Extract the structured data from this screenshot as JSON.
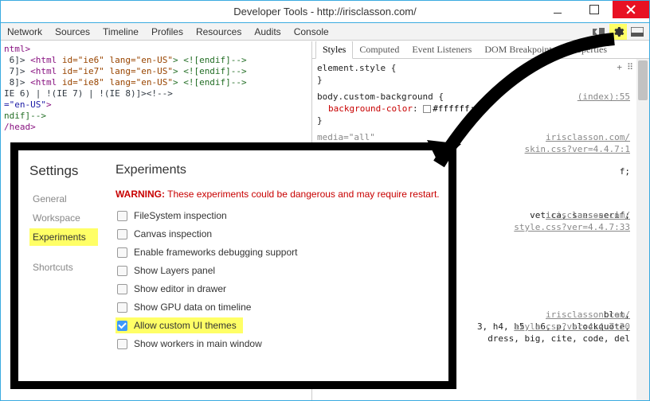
{
  "window": {
    "title": "Developer Tools - http://irisclasson.com/"
  },
  "toolbar": {
    "tabs": [
      "Network",
      "Sources",
      "Timeline",
      "Profiles",
      "Resources",
      "Audits",
      "Console"
    ]
  },
  "html_lines": [
    {
      "pre": "",
      "txt": "ntml>"
    },
    {
      "pre": " 6]> ",
      "tag": "<html ",
      "attr": "id=\"ie6\" lang=\"en-US\"",
      "tail": "> <![endif]-->"
    },
    {
      "pre": " 7]> ",
      "tag": "<html ",
      "attr": "id=\"ie7\" lang=\"en-US\"",
      "tail": "> <![endif]-->"
    },
    {
      "pre": " 8]> ",
      "tag": "<html ",
      "attr": "id=\"ie8\" lang=\"en-US\"",
      "tail": "> <![endif]-->"
    },
    {
      "pre": "",
      "txt": "IE 6) | !(IE 7) | !(IE 8)]><!-->"
    },
    {
      "pre": "",
      "attr2": "=\"en-US\"",
      "tail2": ">"
    },
    {
      "pre": "",
      "cmt": "ndif]-->"
    },
    {
      "pre": "",
      "tag2": "/head>"
    }
  ],
  "styles": {
    "tabs": [
      "Styles",
      "Computed",
      "Event Listeners",
      "DOM Breakpoints",
      "Properties"
    ],
    "active": 0,
    "blocks": [
      {
        "sel": "element.style {",
        "link": "",
        "props": [],
        "close": "}"
      },
      {
        "sel": "body.custom-background {",
        "link": "(index):55",
        "props": [
          {
            "n": "background-color",
            "v": "#ffffff",
            "chip": true
          }
        ],
        "close": "}"
      },
      {
        "sel": "media=\"all\"",
        "link": "irisclasson.com/\nskin.css?ver=4.4.7:1",
        "frag": "f;"
      },
      {
        "link": "irisclasson.com/\nstyle.css?ver=4.4.7:33",
        "frag": "vetica, sans-serif;"
      },
      {
        "link": "irisclasson.com/\nstyle.css?ver=4.4.7:20",
        "frag": "3, h4, h5, h6, p, blockquote,",
        "extra1": "blet,",
        "extra2": "dress, big, cite, code, del"
      }
    ]
  },
  "settings": {
    "title": "Settings",
    "heading": "Experiments",
    "nav": [
      "General",
      "Workspace",
      "Experiments",
      "Shortcuts"
    ],
    "nav_active": 2,
    "warning_label": "WARNING:",
    "warning_text": " These experiments could be dangerous and may require restart.",
    "items": [
      {
        "label": "FileSystem inspection",
        "checked": false,
        "hl": false
      },
      {
        "label": "Canvas inspection",
        "checked": false,
        "hl": false
      },
      {
        "label": "Enable frameworks debugging support",
        "checked": false,
        "hl": false
      },
      {
        "label": "Show Layers panel",
        "checked": false,
        "hl": false
      },
      {
        "label": "Show editor in drawer",
        "checked": false,
        "hl": false
      },
      {
        "label": "Show GPU data on timeline",
        "checked": false,
        "hl": false
      },
      {
        "label": "Allow custom UI themes",
        "checked": true,
        "hl": true
      },
      {
        "label": "Show workers in main window",
        "checked": false,
        "hl": false
      }
    ]
  }
}
